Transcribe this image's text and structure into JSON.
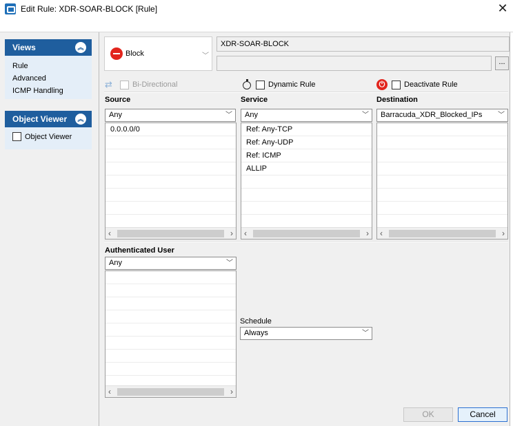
{
  "window": {
    "title": "Edit Rule: XDR-SOAR-BLOCK [Rule]"
  },
  "left_panel": {
    "views": {
      "header": "Views",
      "items": [
        "Rule",
        "Advanced",
        "ICMP Handling"
      ]
    },
    "object_viewer": {
      "header": "Object Viewer",
      "checkbox_label": "Object Viewer"
    }
  },
  "rule": {
    "action": "Block",
    "name": "XDR-SOAR-BLOCK",
    "description": "",
    "ellipsis": "..."
  },
  "options": {
    "bidirectional": "Bi-Directional",
    "dynamic_rule": "Dynamic Rule",
    "deactivate_rule": "Deactivate Rule"
  },
  "source": {
    "title": "Source",
    "selected": "Any",
    "items": [
      "0.0.0.0/0"
    ]
  },
  "service": {
    "title": "Service",
    "selected": "Any",
    "items": [
      "Ref: Any-TCP",
      "Ref: Any-UDP",
      "Ref: ICMP",
      "ALLIP"
    ]
  },
  "destination": {
    "title": "Destination",
    "selected": "Barracuda_XDR_Blocked_IPs",
    "items": []
  },
  "authenticated_user": {
    "title": "Authenticated User",
    "selected": "Any"
  },
  "schedule": {
    "title": "Schedule",
    "selected": "Always"
  },
  "buttons": {
    "ok": "OK",
    "cancel": "Cancel"
  },
  "colors": {
    "header_blue": "#1f5e9e",
    "block_red": "#e2251d"
  },
  "icons": [
    "app-icon",
    "close-icon",
    "chevron-up-icon",
    "block-icon",
    "swap-icon",
    "timer-icon",
    "power-icon"
  ]
}
